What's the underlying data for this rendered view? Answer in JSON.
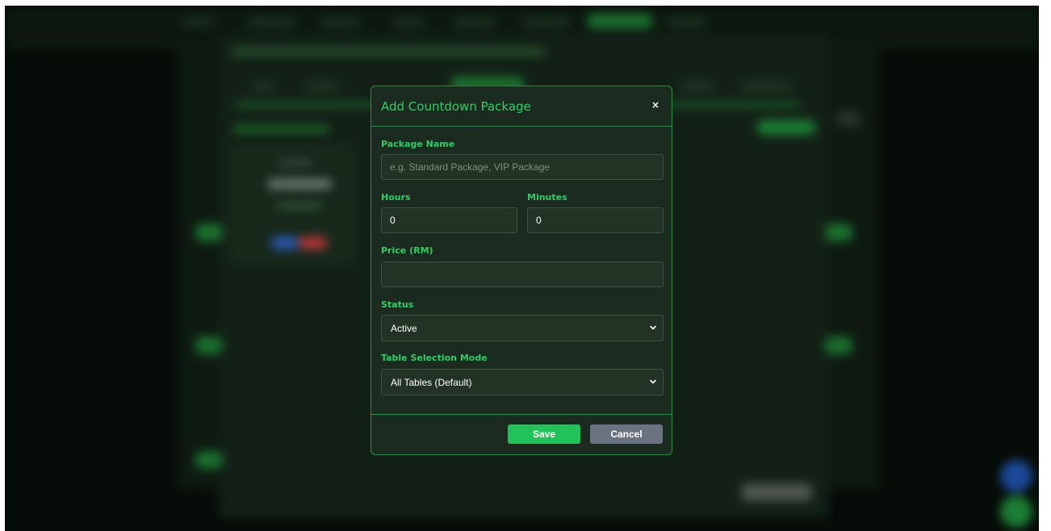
{
  "modal": {
    "title": "Add Countdown Package",
    "close_label": "×",
    "fields": {
      "package_name": {
        "label": "Package Name",
        "placeholder": "e.g. Standard Package, VIP Package",
        "value": ""
      },
      "hours": {
        "label": "Hours",
        "value": "0"
      },
      "minutes": {
        "label": "Minutes",
        "value": "0"
      },
      "price": {
        "label": "Price (RM)",
        "value": ""
      },
      "status": {
        "label": "Status",
        "selected": "Active"
      },
      "table_selection_mode": {
        "label": "Table Selection Mode",
        "selected": "All Tables (Default)"
      }
    },
    "buttons": {
      "save_label": "Save",
      "cancel_label": "Cancel"
    }
  },
  "colors": {
    "accent": "#33cc66",
    "modal_bg": "#1c2b1f",
    "modal_border": "#2e8a45",
    "input_bg": "#223224",
    "save_bg": "#22c25a",
    "cancel_bg": "#6b7280",
    "backdrop": "#060c07"
  },
  "icons": {
    "close": "close-icon",
    "dropdown": "chevron-down-icon"
  }
}
